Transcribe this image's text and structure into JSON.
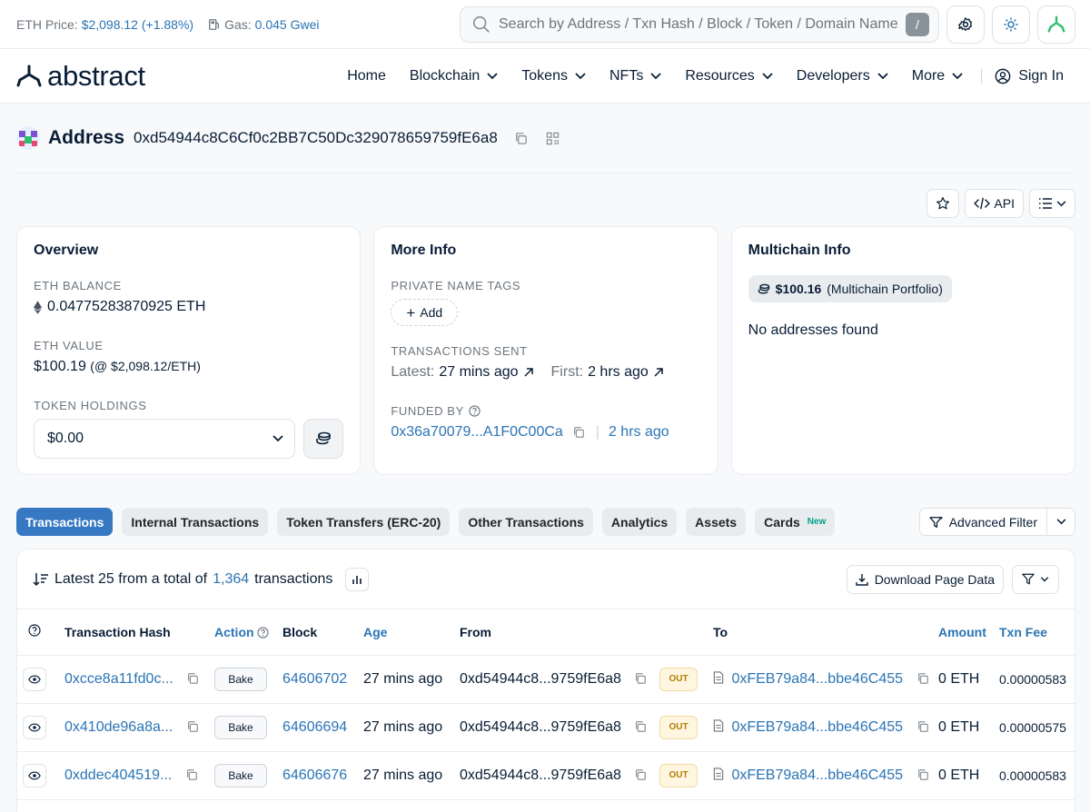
{
  "topbar": {
    "eth_price_label": "ETH Price:",
    "eth_price_value": "$2,098.12 (+1.88%)",
    "gas_label": "Gas:",
    "gas_value": "0.045 Gwei",
    "search_placeholder": "Search by Address / Txn Hash / Block / Token / Domain Name",
    "search_shortcut": "/"
  },
  "nav": {
    "logo_text": "abstract",
    "items": [
      "Home",
      "Blockchain",
      "Tokens",
      "NFTs",
      "Resources",
      "Developers",
      "More"
    ],
    "sign_in": "Sign In"
  },
  "address": {
    "title": "Address",
    "hash": "0xd54944c8C6Cf0c2BB7C50Dc329078659759fE6a8"
  },
  "actions": {
    "api_label": "API"
  },
  "overview": {
    "title": "Overview",
    "eth_balance_label": "ETH BALANCE",
    "eth_balance": "0.04775283870925 ETH",
    "eth_value_label": "ETH VALUE",
    "eth_value": "$100.19",
    "eth_value_rate": "(@ $2,098.12/ETH)",
    "token_holdings_label": "TOKEN HOLDINGS",
    "token_holdings": "$0.00"
  },
  "more_info": {
    "title": "More Info",
    "private_tags_label": "PRIVATE NAME TAGS",
    "add_label": "Add",
    "tx_sent_label": "TRANSACTIONS SENT",
    "latest_label": "Latest:",
    "latest_value": "27 mins ago",
    "first_label": "First:",
    "first_value": "2 hrs ago",
    "funded_by_label": "FUNDED BY",
    "funded_by_addr": "0x36a70079...A1F0C00Ca",
    "funded_by_age": "2 hrs ago"
  },
  "multichain": {
    "title": "Multichain Info",
    "portfolio_value": "$100.16",
    "portfolio_label": "(Multichain Portfolio)",
    "no_addresses": "No addresses found"
  },
  "tabs": {
    "items": [
      "Transactions",
      "Internal Transactions",
      "Token Transfers (ERC-20)",
      "Other Transactions",
      "Analytics",
      "Assets",
      "Cards"
    ],
    "new_badge": "New",
    "advanced_filter": "Advanced Filter"
  },
  "txtable": {
    "summary_prefix": "Latest 25 from a total of",
    "summary_count": "1,364",
    "summary_suffix": "transactions",
    "download_label": "Download Page Data",
    "columns": [
      "Transaction Hash",
      "Action",
      "Block",
      "Age",
      "From",
      "To",
      "Amount",
      "Txn Fee"
    ],
    "rows": [
      {
        "hash": "0xcce8a11fd0c...",
        "method": "Bake",
        "block": "64606702",
        "age": "27 mins ago",
        "from": "0xd54944c8...9759fE6a8",
        "direction": "OUT",
        "to": "0xFEB79a84...bbe46C455",
        "amount": "0 ETH",
        "fee": "0.00000583"
      },
      {
        "hash": "0x410de96a8a...",
        "method": "Bake",
        "block": "64606694",
        "age": "27 mins ago",
        "from": "0xd54944c8...9759fE6a8",
        "direction": "OUT",
        "to": "0xFEB79a84...bbe46C455",
        "amount": "0 ETH",
        "fee": "0.00000575"
      },
      {
        "hash": "0xddec404519...",
        "method": "Bake",
        "block": "64606676",
        "age": "27 mins ago",
        "from": "0xd54944c8...9759fE6a8",
        "direction": "OUT",
        "to": "0xFEB79a84...bbe46C455",
        "amount": "0 ETH",
        "fee": "0.00000583"
      }
    ]
  }
}
